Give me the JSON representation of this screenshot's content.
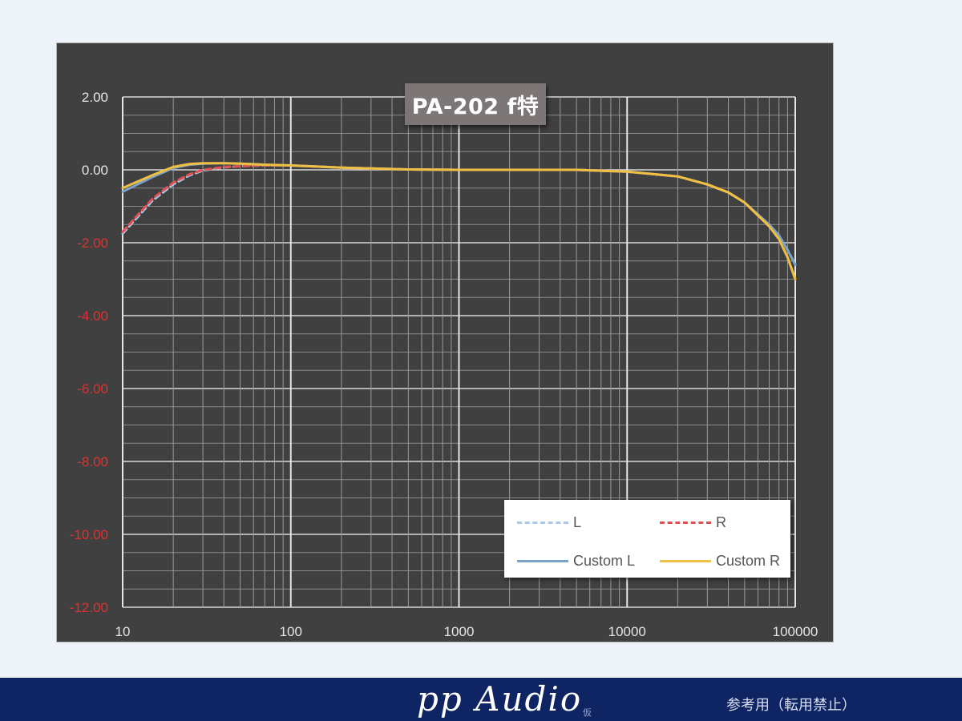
{
  "chart_data": {
    "type": "line",
    "title": "PA-202  f特",
    "xscale": "log",
    "xlim": [
      10,
      100000
    ],
    "ylim": [
      -12,
      2
    ],
    "x_ticks": [
      10,
      100,
      1000,
      10000,
      100000
    ],
    "x_tick_labels": [
      "10",
      "100",
      "1000",
      "10000",
      "100000"
    ],
    "y_ticks": [
      2,
      0,
      -2,
      -4,
      -6,
      -8,
      -10,
      -12
    ],
    "y_tick_labels": [
      "2.00",
      "0.00",
      "-2.00",
      "-4.00",
      "-6.00",
      "-8.00",
      "-10.00",
      "-12.00"
    ],
    "y_tick_colors": {
      "positive_zero": "#e6e6e6",
      "negative": "#e03030"
    },
    "grid": true,
    "legend_position": "bottom-right",
    "series": [
      {
        "name": "L",
        "color": "#a8c8e8",
        "dash": true,
        "x": [
          10,
          15,
          20,
          25,
          30,
          40,
          50,
          70,
          100,
          200,
          500,
          1000,
          5000,
          10000,
          20000,
          30000,
          40000,
          50000,
          70000,
          80000,
          90000,
          100000
        ],
        "y": [
          -1.75,
          -0.85,
          -0.4,
          -0.15,
          -0.02,
          0.07,
          0.1,
          0.12,
          0.12,
          0.06,
          0.01,
          0.0,
          0.0,
          -0.05,
          -0.18,
          -0.4,
          -0.62,
          -0.9,
          -1.5,
          -1.8,
          -2.2,
          -2.6
        ]
      },
      {
        "name": "R",
        "color": "#e05050",
        "dash": true,
        "x": [
          10,
          15,
          20,
          25,
          30,
          40,
          50,
          70,
          100,
          200,
          500,
          1000,
          5000,
          10000,
          20000,
          30000,
          40000,
          50000,
          70000,
          80000,
          90000,
          100000
        ],
        "y": [
          -1.7,
          -0.8,
          -0.35,
          -0.12,
          0.0,
          0.08,
          0.1,
          0.12,
          0.12,
          0.06,
          0.01,
          0.0,
          0.0,
          -0.05,
          -0.18,
          -0.4,
          -0.62,
          -0.9,
          -1.55,
          -1.9,
          -2.4,
          -3.0
        ]
      },
      {
        "name": "Custom L",
        "color": "#7ba3c9",
        "dash": false,
        "x": [
          10,
          15,
          20,
          25,
          30,
          40,
          50,
          70,
          100,
          200,
          500,
          1000,
          5000,
          10000,
          20000,
          30000,
          40000,
          50000,
          70000,
          80000,
          90000,
          100000
        ],
        "y": [
          -0.6,
          -0.2,
          0.05,
          0.14,
          0.17,
          0.18,
          0.17,
          0.14,
          0.12,
          0.06,
          0.01,
          0.0,
          0.0,
          -0.05,
          -0.18,
          -0.4,
          -0.62,
          -0.9,
          -1.5,
          -1.8,
          -2.2,
          -2.6
        ]
      },
      {
        "name": "Custom R",
        "color": "#f0c040",
        "dash": false,
        "x": [
          10,
          15,
          20,
          25,
          30,
          40,
          50,
          70,
          100,
          200,
          500,
          1000,
          5000,
          10000,
          20000,
          30000,
          40000,
          50000,
          70000,
          80000,
          90000,
          100000
        ],
        "y": [
          -0.5,
          -0.15,
          0.08,
          0.16,
          0.18,
          0.18,
          0.17,
          0.14,
          0.12,
          0.06,
          0.01,
          0.0,
          0.0,
          -0.05,
          -0.18,
          -0.4,
          -0.62,
          -0.9,
          -1.55,
          -1.9,
          -2.4,
          -3.0
        ]
      }
    ]
  },
  "footer": {
    "brand": "pp Audio",
    "brand_sub": "仮",
    "notice": "参考用（転用禁止）"
  }
}
